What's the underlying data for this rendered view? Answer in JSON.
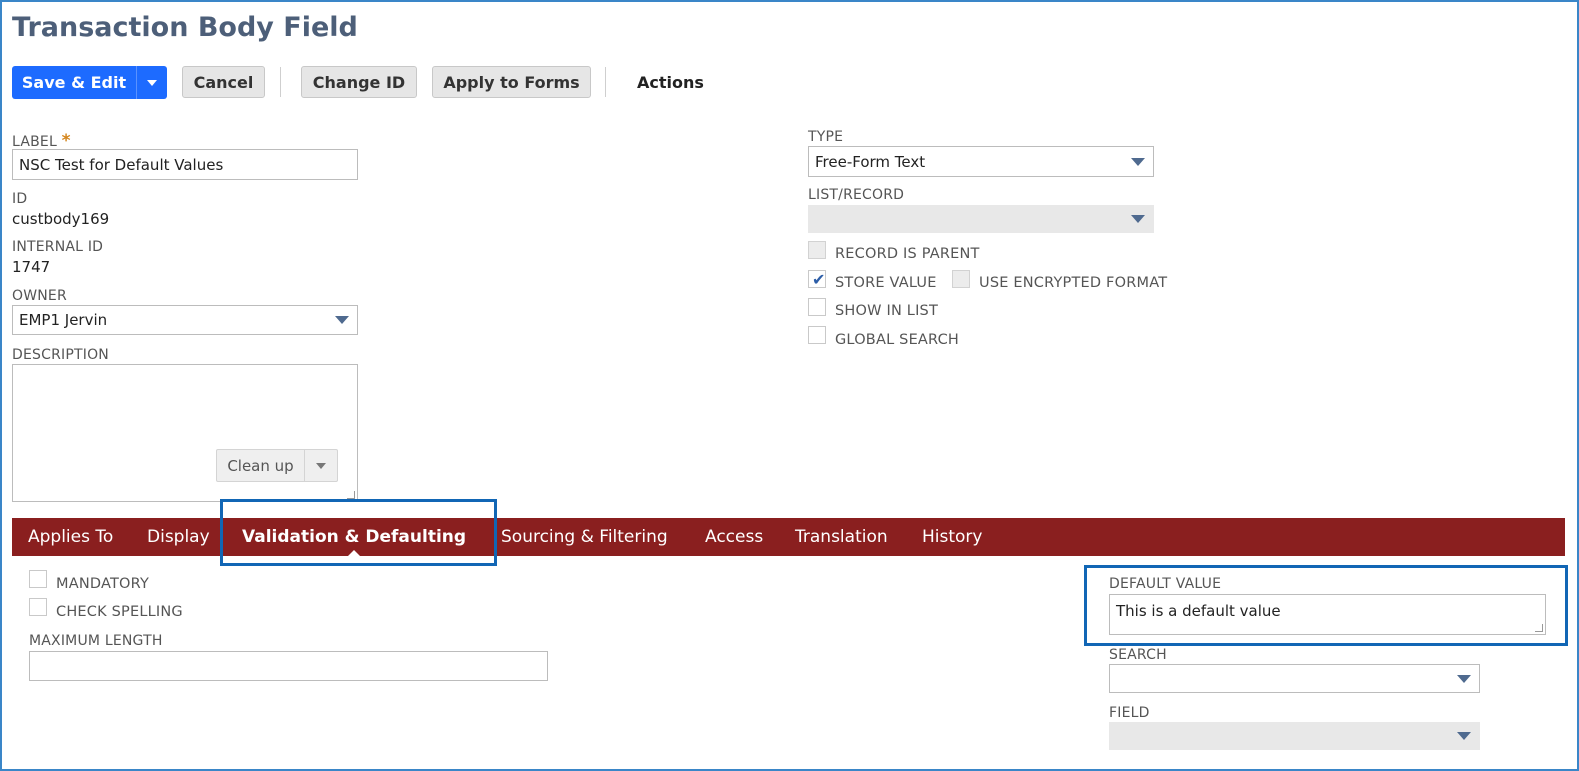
{
  "page": {
    "title": "Transaction Body Field"
  },
  "toolbar": {
    "save_edit": "Save & Edit",
    "cancel": "Cancel",
    "change_id": "Change ID",
    "apply_to_forms": "Apply to Forms",
    "actions": "Actions"
  },
  "form": {
    "label": {
      "label": "LABEL",
      "required": "*",
      "value": "NSC Test for Default Values"
    },
    "id": {
      "label": "ID",
      "value": "custbody169"
    },
    "internal_id": {
      "label": "INTERNAL ID",
      "value": "1747"
    },
    "owner": {
      "label": "OWNER",
      "value": "EMP1 Jervin"
    },
    "description": {
      "label": "DESCRIPTION",
      "value": "",
      "cleanup": "Clean up"
    },
    "type": {
      "label": "TYPE",
      "value": "Free-Form Text"
    },
    "list_record": {
      "label": "LIST/RECORD",
      "value": ""
    },
    "record_is_parent": {
      "label": "RECORD IS PARENT",
      "checked": false
    },
    "store_value": {
      "label": "STORE VALUE",
      "checked": true
    },
    "use_encrypted_format": {
      "label": "USE ENCRYPTED FORMAT",
      "checked": false
    },
    "show_in_list": {
      "label": "SHOW IN LIST",
      "checked": false
    },
    "global_search": {
      "label": "GLOBAL SEARCH",
      "checked": false
    }
  },
  "tabs": [
    {
      "label": "Applies To",
      "active": false
    },
    {
      "label": "Display",
      "active": false
    },
    {
      "label": "Validation & Defaulting",
      "active": true
    },
    {
      "label": "Sourcing & Filtering",
      "active": false
    },
    {
      "label": "Access",
      "active": false
    },
    {
      "label": "Translation",
      "active": false
    },
    {
      "label": "History",
      "active": false
    }
  ],
  "validation": {
    "mandatory": {
      "label": "MANDATORY",
      "checked": false
    },
    "check_spelling": {
      "label": "CHECK SPELLING",
      "checked": false
    },
    "maximum_length": {
      "label": "MAXIMUM LENGTH",
      "value": ""
    },
    "default_value": {
      "label": "DEFAULT VALUE",
      "value": "This is a default value"
    },
    "search": {
      "label": "SEARCH",
      "value": ""
    },
    "field": {
      "label": "FIELD",
      "value": ""
    }
  },
  "colors": {
    "primary_button": "#1d6bff",
    "tab_bar": "#8a1f1f",
    "highlight_box": "#1166b5",
    "title": "#4d5f79"
  },
  "icons": {
    "dropdown": "caret-down-icon",
    "check": "checkmark-icon"
  }
}
